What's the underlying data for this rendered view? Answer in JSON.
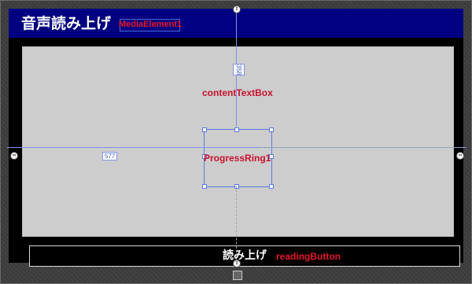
{
  "app": {
    "title": "音声読み上げ"
  },
  "designer": {
    "media_element_label": "MediaElement1",
    "content_textbox_label": "contentTextBox",
    "progress_ring_label": "ProgressRing1",
    "reading_button_label": "readingButton",
    "dimension_width": "577",
    "dimension_height": "358"
  },
  "reading_button": {
    "text": "読み上げ"
  },
  "colors": {
    "title_bar": "#000080",
    "content_bg": "#cdcdcd",
    "label_red": "#e8182a",
    "guide_blue": "#7e93e3"
  }
}
